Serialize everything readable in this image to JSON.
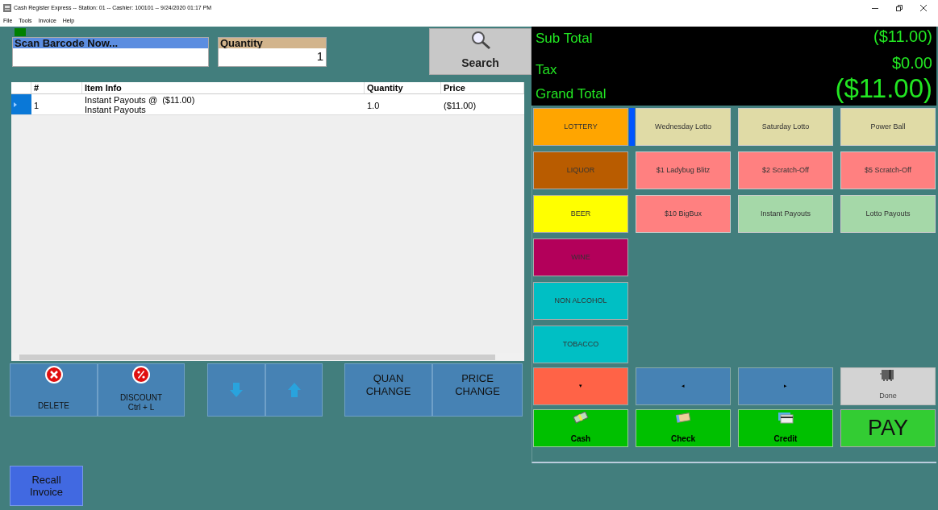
{
  "window": {
    "title": "Cash Register Express -- Station: 01 -- Cashier: 100101 -- 9/24/2020 01:17 PM"
  },
  "menu": [
    "File",
    "Tools",
    "Invoice",
    "Help"
  ],
  "scan_field": {
    "label": "Scan Barcode Now..."
  },
  "quantity_field": {
    "label": "Quantity",
    "value": "1"
  },
  "search_button": {
    "label": "Search"
  },
  "table": {
    "columns": [
      "#",
      "Item Info",
      "Quantity",
      "Price"
    ],
    "rows": [
      {
        "selected": true,
        "number": "1",
        "item_info": [
          "Instant Payouts @  ($11.00)",
          "Instant Payouts"
        ],
        "quantity": "1.0",
        "price": "($11.00)"
      }
    ]
  },
  "action_groups": [
    [
      {
        "kind": "delete",
        "lines": [
          "DELETE"
        ]
      },
      {
        "kind": "discount",
        "lines": [
          "DISCOUNT",
          "Ctrl + L"
        ]
      }
    ],
    [
      {
        "kind": "down"
      },
      {
        "kind": "up"
      }
    ],
    [
      {
        "kind": "text",
        "lines": [
          "QUAN",
          "CHANGE"
        ]
      },
      {
        "kind": "text",
        "lines": [
          "PRICE",
          "CHANGE"
        ]
      }
    ]
  ],
  "recall_button": {
    "lines": [
      "Recall",
      "Invoice"
    ]
  },
  "totals": [
    {
      "kind": "sub",
      "label": "Sub Total",
      "value": "($11.00)"
    },
    {
      "kind": "tax",
      "label": "Tax",
      "value": "$0.00"
    },
    {
      "kind": "grand",
      "label": "Grand Total",
      "value": "($11.00)"
    }
  ],
  "categories": [
    {
      "label": "LOTTERY",
      "color": "#ffa500",
      "selected": true
    },
    {
      "label": "LIQUOR",
      "color": "#b95c00",
      "selected": false
    },
    {
      "label": "BEER",
      "color": "#ffff00",
      "selected": false
    },
    {
      "label": "WINE",
      "color": "#b3005a",
      "selected": false
    },
    {
      "label": "NON ALCOHOL",
      "color": "#00bfc4",
      "selected": false
    },
    {
      "label": "TOBACCO",
      "color": "#00bfc4",
      "selected": false
    }
  ],
  "products": [
    {
      "label": "Wednesday Lotto",
      "color": "#e0dba6"
    },
    {
      "label": "Saturday Lotto",
      "color": "#e0dba6"
    },
    {
      "label": "Power Ball",
      "color": "#e0dba6"
    },
    {
      "label": "$1 Ladybug Blitz",
      "color": "#ff8080"
    },
    {
      "label": "$2 Scratch-Off",
      "color": "#ff8080"
    },
    {
      "label": "$5 Scratch-Off",
      "color": "#ff8080"
    },
    {
      "label": "$10 BigBux",
      "color": "#ff8080"
    },
    {
      "label": "Instant Payouts",
      "color": "#a5d8a8"
    },
    {
      "label": "Lotto Payouts",
      "color": "#a5d8a8"
    }
  ],
  "nav_buttons": [
    {
      "kind": "glyph",
      "glyph": "▾",
      "color": "#ff6347"
    },
    {
      "kind": "glyph",
      "glyph": "◂",
      "color": "#4682b4"
    },
    {
      "kind": "glyph",
      "glyph": "▸",
      "color": "#4682b4"
    },
    {
      "kind": "done",
      "label": "Done",
      "color": "#d3d3d3"
    }
  ],
  "payments": [
    {
      "kind": "cash",
      "label": "Cash"
    },
    {
      "kind": "check",
      "label": "Check"
    },
    {
      "kind": "credit",
      "label": "Credit"
    },
    {
      "kind": "pay",
      "label": "PAY"
    }
  ]
}
